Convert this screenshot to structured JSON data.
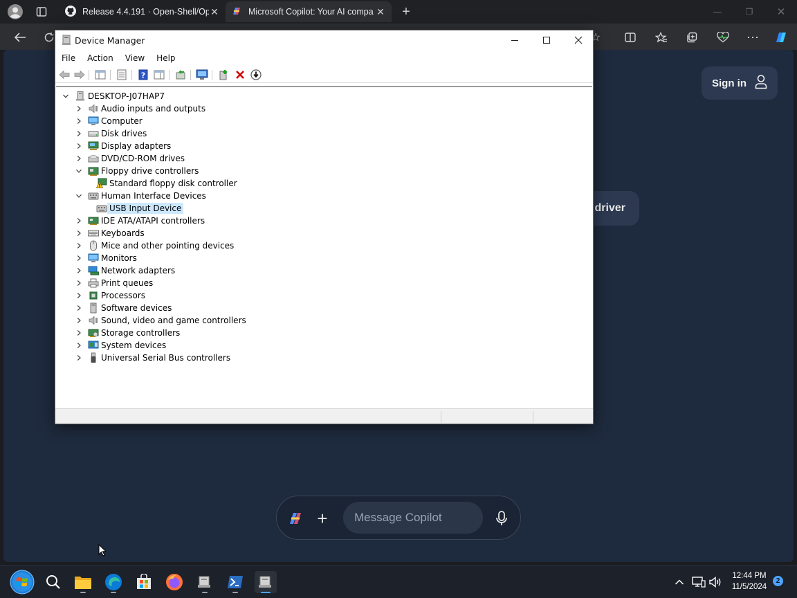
{
  "browser": {
    "tabs": [
      {
        "title": "Release 4.4.191 · Open-Shell/Ope",
        "icon": "github-icon"
      },
      {
        "title": "Microsoft Copilot: Your AI compa",
        "icon": "copilot-icon",
        "active": true
      }
    ]
  },
  "copilot": {
    "sign_in_label": "Sign in",
    "driver_text": "driver",
    "message_placeholder": "Message Copilot"
  },
  "device_manager": {
    "title": "Device Manager",
    "menu": [
      "File",
      "Action",
      "View",
      "Help"
    ],
    "computer_name": "DESKTOP-J07HAP7",
    "categories": [
      {
        "label": "Audio inputs and outputs",
        "expanded": false,
        "icon": "speaker-icon"
      },
      {
        "label": "Computer",
        "expanded": false,
        "icon": "monitor-icon"
      },
      {
        "label": "Disk drives",
        "expanded": false,
        "icon": "disk-icon"
      },
      {
        "label": "Display adapters",
        "expanded": false,
        "icon": "display-adapter-icon"
      },
      {
        "label": "DVD/CD-ROM drives",
        "expanded": false,
        "icon": "dvd-icon"
      },
      {
        "label": "Floppy drive controllers",
        "expanded": true,
        "icon": "floppy-controller-icon",
        "children": [
          {
            "label": "Standard floppy disk controller",
            "icon": "warning-device-icon",
            "warning": true
          }
        ]
      },
      {
        "label": "Human Interface Devices",
        "expanded": true,
        "icon": "hid-icon",
        "children": [
          {
            "label": "USB Input Device",
            "icon": "hid-icon",
            "selected": true
          }
        ]
      },
      {
        "label": "IDE ATA/ATAPI controllers",
        "expanded": false,
        "icon": "ide-icon"
      },
      {
        "label": "Keyboards",
        "expanded": false,
        "icon": "keyboard-icon"
      },
      {
        "label": "Mice and other pointing devices",
        "expanded": false,
        "icon": "mouse-icon"
      },
      {
        "label": "Monitors",
        "expanded": false,
        "icon": "monitor-icon"
      },
      {
        "label": "Network adapters",
        "expanded": false,
        "icon": "network-icon"
      },
      {
        "label": "Print queues",
        "expanded": false,
        "icon": "printer-icon"
      },
      {
        "label": "Processors",
        "expanded": false,
        "icon": "cpu-icon"
      },
      {
        "label": "Software devices",
        "expanded": false,
        "icon": "software-device-icon"
      },
      {
        "label": "Sound, video and game controllers",
        "expanded": false,
        "icon": "speaker-icon"
      },
      {
        "label": "Storage controllers",
        "expanded": false,
        "icon": "storage-icon"
      },
      {
        "label": "System devices",
        "expanded": false,
        "icon": "system-icon"
      },
      {
        "label": "Universal Serial Bus controllers",
        "expanded": false,
        "icon": "usb-icon"
      }
    ]
  },
  "taskbar": {
    "time": "12:44 PM",
    "date": "11/5/2024",
    "notification_count": "2"
  },
  "colors": {
    "page_bg": "#1e2a3d",
    "selection": "#cce8ff",
    "uninstall_red": "#d40000"
  }
}
